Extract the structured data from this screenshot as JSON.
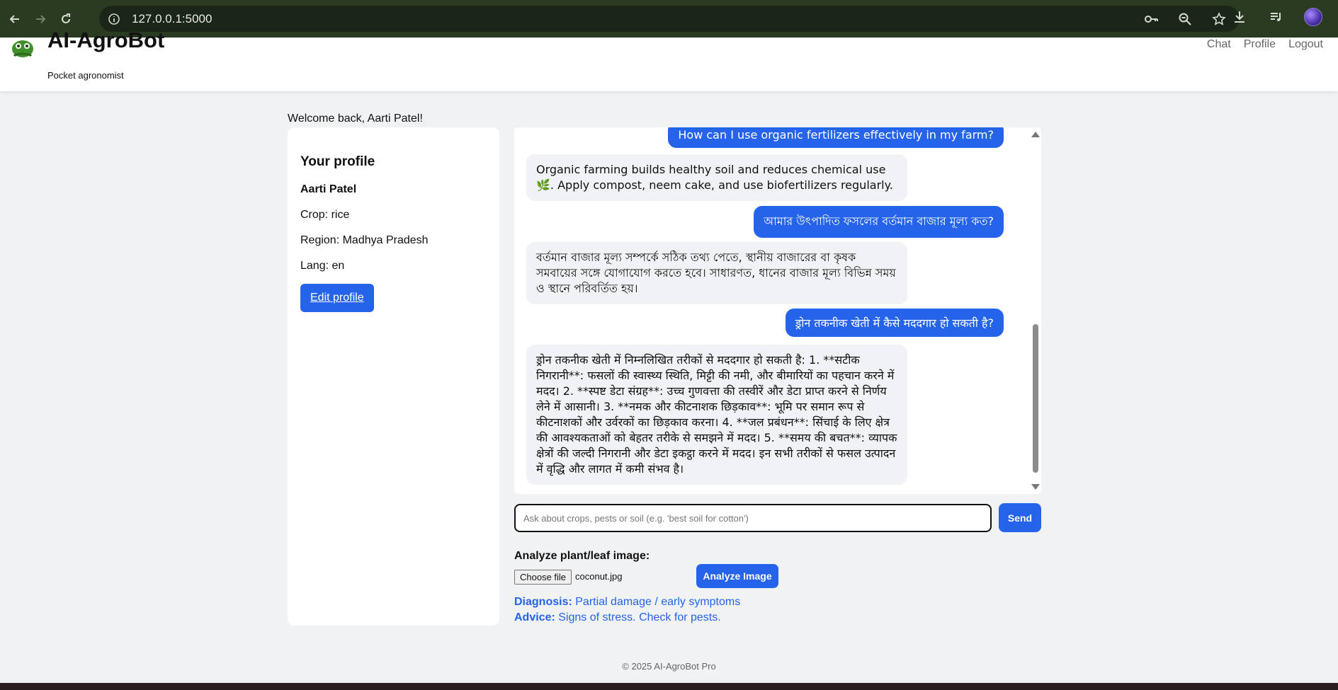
{
  "browser": {
    "url": "127.0.0.1:5000",
    "icons": [
      "back-icon",
      "forward-icon",
      "reload-icon",
      "site-info-icon",
      "key-icon",
      "zoom-icon",
      "star-icon",
      "download-icon",
      "media-icon",
      "profile-avatar"
    ]
  },
  "header": {
    "brand": "AI-AgroBot",
    "tagline": "Pocket agronomist",
    "nav": {
      "chat": "Chat",
      "profile": "Profile",
      "logout": "Logout"
    }
  },
  "welcome": "Welcome back, Aarti Patel!",
  "profile": {
    "title": "Your profile",
    "name": "Aarti Patel",
    "crop": "Crop: rice",
    "region": "Region: Madhya Pradesh",
    "lang": "Lang: en",
    "edit_label": "Edit profile"
  },
  "chat": {
    "messages": [
      {
        "role": "user",
        "text": "How can I use organic fertilizers effectively in my farm?"
      },
      {
        "role": "bot",
        "text": "Organic farming builds healthy soil and reduces chemical use 🌿. Apply compost, neem cake, and use biofertilizers regularly."
      },
      {
        "role": "user",
        "text": "আমার উৎপাদিত ফসলের বর্তমান বাজার মূল্য কত?"
      },
      {
        "role": "bot",
        "text": "বর্তমান বাজার মূল্য সম্পর্কে সঠিক তথ্য পেতে, স্থানীয় বাজারের বা কৃষক সমবায়ের সঙ্গে যোগাযোগ করতে হবে। সাধারণত, ধানের বাজার মূল্য বিভিন্ন সময় ও স্থানে পরিবর্তিত হয়।"
      },
      {
        "role": "user",
        "text": "ड्रोन तकनीक खेती में कैसे मददगार हो सकती है?"
      },
      {
        "role": "bot",
        "text": "ड्रोन तकनीक खेती में निम्नलिखित तरीकों से मददगार हो सकती है: 1. **सटीक निगरानी**: फसलों की स्वास्थ्य स्थिति, मिट्टी की नमी, और बीमारियों का पहचान करने में मदद। 2. **स्पष्ट डेटा संग्रह**: उच्च गुणवत्ता की तस्वीरें और डेटा प्राप्त करने से निर्णय लेने में आसानी। 3. **नमक और कीटनाशक छिड़काव**: भूमि पर समान रूप से कीटनाशकों और उर्वरकों का छिड़काव करना। 4. **जल प्रबंधन**: सिंचाई के लिए क्षेत्र की आवश्यकताओं को बेहतर तरीके से समझने में मदद। 5. **समय की बचत**: व्यापक क्षेत्रों की जल्दी निगरानी और डेटा इकट्ठा करने में मदद। इन सभी तरीकों से फसल उत्पादन में वृद्धि और लागत में कमी संभव है।"
      }
    ],
    "input_placeholder": "Ask about crops, pests or soil (e.g. 'best soil for cotton')",
    "input_value": "",
    "send_label": "Send"
  },
  "image_analysis": {
    "label": "Analyze plant/leaf image:",
    "choose_label": "Choose file",
    "file_name": "coconut.jpg",
    "analyze_label": "Analyze Image",
    "diagnosis_label": "Diagnosis:",
    "diagnosis_value": "Partial damage / early symptoms",
    "advice_label": "Advice:",
    "advice_value": "Signs of stress. Check for pests."
  },
  "footer": "© 2025 AI-AgroBot Pro",
  "colors": {
    "accent": "#2563eb",
    "background": "#f1f2f4",
    "browser_chrome": "#2b3b22"
  }
}
